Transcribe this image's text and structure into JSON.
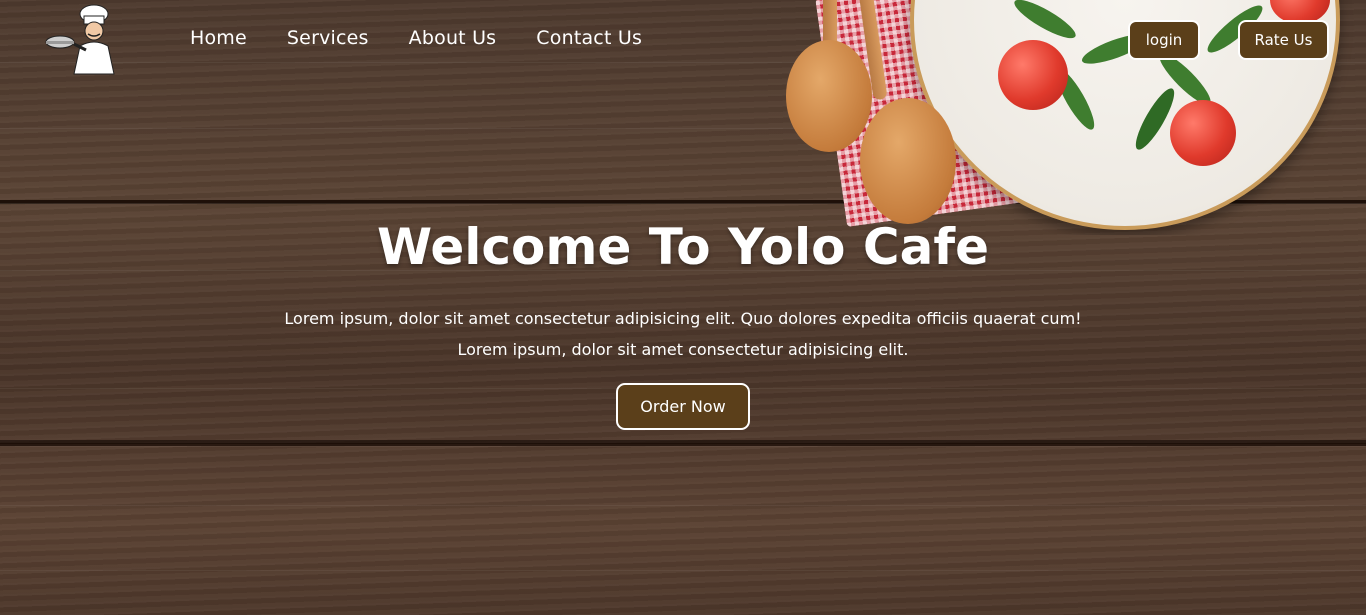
{
  "brand": {
    "logo_icon": "chef-logo-icon"
  },
  "nav": {
    "items": [
      {
        "label": "Home"
      },
      {
        "label": "Services"
      },
      {
        "label": "About Us"
      },
      {
        "label": "Contact Us"
      }
    ]
  },
  "header_actions": {
    "login_label": "login",
    "rate_label": "Rate Us"
  },
  "hero": {
    "title": "Welcome To Yolo Cafe",
    "line1": "Lorem ipsum, dolor sit amet consectetur adipisicing elit. Quo dolores expedita officiis quaerat cum!",
    "line2": "Lorem ipsum, dolor sit amet consectetur adipisicing elit.",
    "cta_label": "Order Now"
  },
  "colors": {
    "button_bg": "#5b3f1a",
    "wood_base": "#4e3a2e",
    "text": "#ffffff"
  }
}
